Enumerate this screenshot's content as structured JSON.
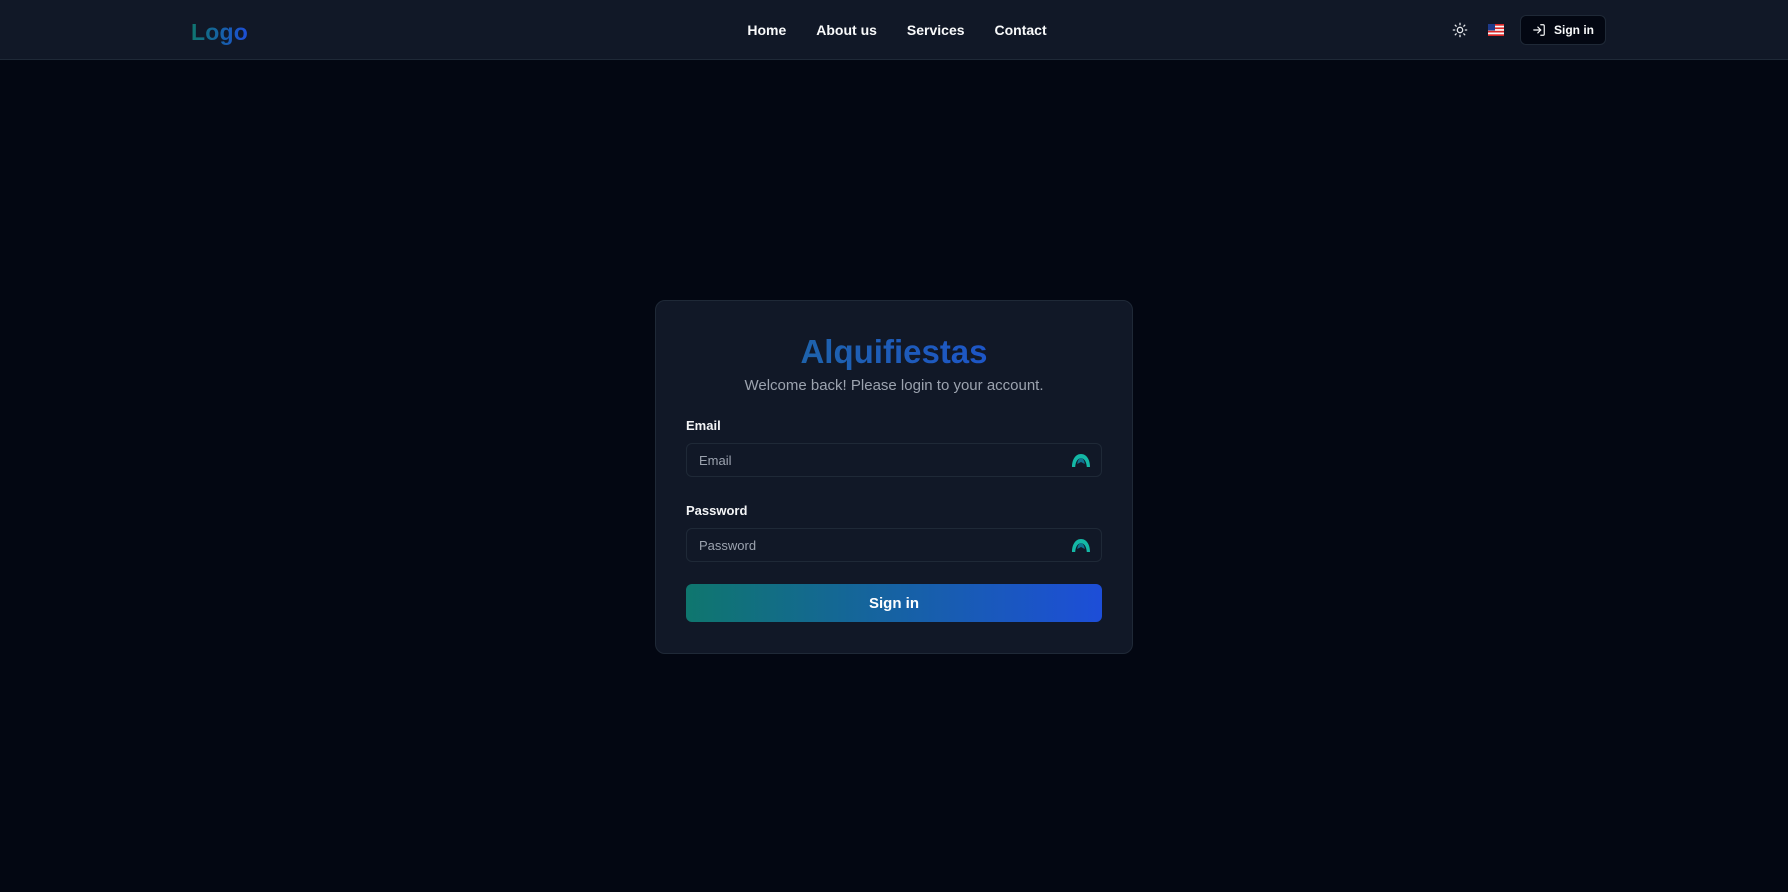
{
  "header": {
    "logo": "Logo",
    "nav": [
      {
        "label": "Home"
      },
      {
        "label": "About us"
      },
      {
        "label": "Services"
      },
      {
        "label": "Contact"
      }
    ],
    "theme_icon": "sun-icon",
    "language_icon": "us-flag-icon",
    "signin_icon": "sign-in-icon",
    "signin_label": "Sign in"
  },
  "login": {
    "title": "Alquifiestas",
    "subtitle": "Welcome back! Please login to your account.",
    "email_label": "Email",
    "email_placeholder": "Email",
    "email_value": "",
    "password_label": "Password",
    "password_placeholder": "Password",
    "password_value": "",
    "field_addon_icon": "password-manager-icon",
    "submit_label": "Sign in"
  },
  "colors": {
    "background": "#030712",
    "surface": "#111827",
    "border": "#1f2937",
    "accent_start": "#0f766e",
    "accent_end": "#1d4ed8",
    "addon_icon": "#14b8a6"
  }
}
